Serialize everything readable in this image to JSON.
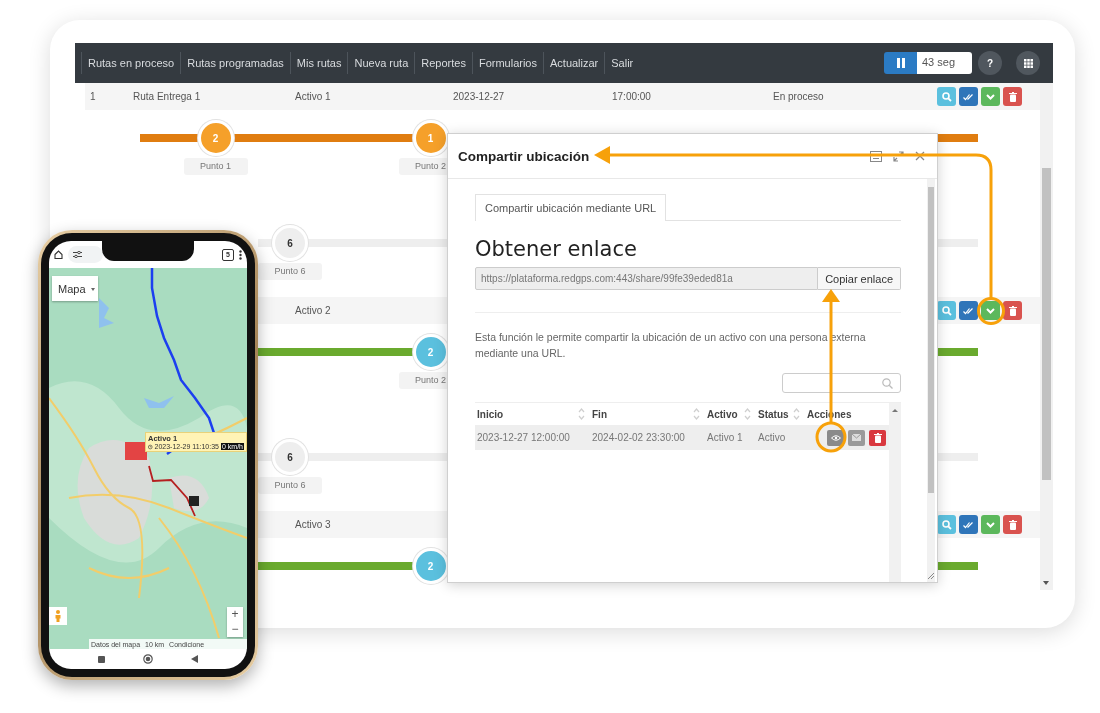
{
  "navbar": {
    "menu": [
      "Rutas en proceso",
      "Rutas programadas",
      "Mis rutas",
      "Nueva ruta",
      "Reportes",
      "Formularios",
      "Actualizar",
      "Salir"
    ],
    "refresh_interval": "43 seg",
    "help": "?"
  },
  "routes": [
    {
      "color": "#e07d10",
      "row": {
        "number": "1",
        "route": "Ruta Entrega 1",
        "asset": "Activo 1",
        "date": "2023-12-27",
        "time": "17:00:00",
        "status": "En proceso"
      },
      "points": [
        {
          "kind": "start",
          "number": "2",
          "label": "Punto 1",
          "color": "#f5a02a"
        },
        {
          "kind": "waypoint",
          "number": "1",
          "label": "Punto 2",
          "color": "#f5a02a"
        }
      ],
      "last_point": {
        "number": "6",
        "label": "Punto 6"
      }
    },
    {
      "color": "#6aaa2e",
      "row": {
        "asset": "Activo 2"
      },
      "points": [
        {
          "kind": "waypoint",
          "number": "2",
          "label": "Punto 2",
          "color": "#5bc0de"
        }
      ],
      "last_point": {
        "number": "6",
        "label": "Punto 6"
      }
    },
    {
      "color": "#6aaa2e",
      "row": {
        "asset": "Activo 3"
      },
      "points": [
        {
          "kind": "waypoint",
          "number": "2",
          "color": "#5bc0de"
        }
      ]
    }
  ],
  "dialog": {
    "title": "Compartir ubicación",
    "tabs": [
      {
        "label": "Compartir ubicación mediante URL",
        "selected": true
      }
    ],
    "heading": "Obtener enlace",
    "link": "https://plataforma.redgps.com:443/share/99fe39eded81a",
    "copy_button": "Copiar enlace",
    "description": "Esta función le permite compartir la ubicación de un activo con una persona externa mediante una URL.",
    "table": {
      "columns": [
        {
          "label": "Inicio",
          "sortable": true
        },
        {
          "label": "Fin",
          "sortable": true
        },
        {
          "label": "Activo",
          "sortable": true
        },
        {
          "label": "Status",
          "sortable": true
        },
        {
          "label": "Acciones",
          "sortable": false
        }
      ],
      "rows": [
        [
          "2023-12-27 12:00:00",
          "2024-02-02 23:30:00",
          "Activo 1",
          "Activo"
        ]
      ]
    }
  },
  "phone": {
    "tab_count": "5",
    "map_type": "Mapa",
    "popup": {
      "title": "Activo 1",
      "timestamp": "2023-12-29 11:10:35",
      "speed": "0 km/h"
    },
    "zoom_in": "+",
    "zoom_out": "−",
    "attribution": [
      "Datos del mapa",
      "10 km",
      "Condicione"
    ]
  }
}
